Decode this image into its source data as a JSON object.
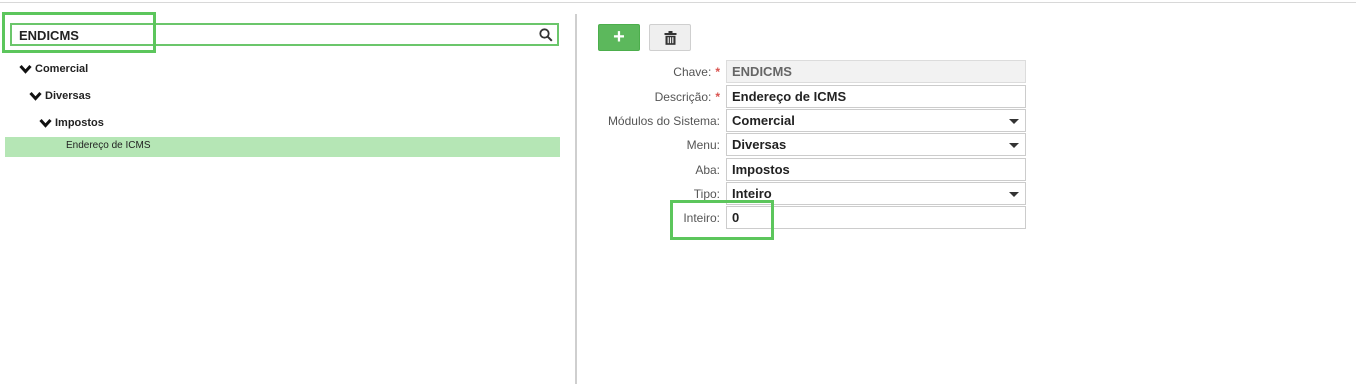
{
  "search": {
    "value": "ENDICMS"
  },
  "tree": {
    "nodes": [
      {
        "label": "Comercial"
      },
      {
        "label": "Diversas"
      },
      {
        "label": "Impostos"
      }
    ],
    "selected_leaf": "Endereço de ICMS"
  },
  "toolbar": {
    "add_label": "+"
  },
  "form": {
    "chave": {
      "label": "Chave:",
      "value": "ENDICMS",
      "required": "*"
    },
    "descricao": {
      "label": "Descrição:",
      "value": "Endereço de ICMS",
      "required": "*"
    },
    "modulos": {
      "label": "Módulos do Sistema:",
      "value": "Comercial"
    },
    "menu": {
      "label": "Menu:",
      "value": "Diversas"
    },
    "aba": {
      "label": "Aba:",
      "value": "Impostos"
    },
    "tipo": {
      "label": "Tipo:",
      "value": "Inteiro"
    },
    "inteiro": {
      "label": "Inteiro:",
      "value": "0"
    }
  },
  "colors": {
    "accent_green": "#5cb85c",
    "highlight_green": "#5cc65c",
    "selected_row": "#b5e6b5",
    "required": "#d9534f"
  }
}
